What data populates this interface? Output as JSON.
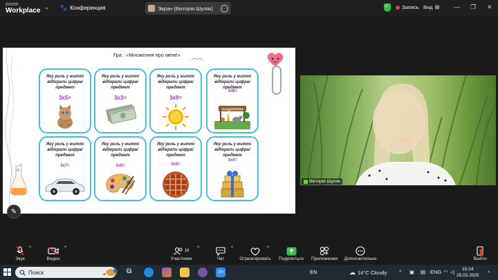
{
  "topbar": {
    "brand_top": "zoom",
    "brand_bottom": "Workplace",
    "meeting_label": "Конференция",
    "share_label": "Экран (Вікторія Шуляк)",
    "record_label": "Запись",
    "view_label": "Вид"
  },
  "slide": {
    "title": "Гра : «Множення про мене»",
    "question": "Яку роль у житті відіграли цифра/предмет",
    "cards": [
      {
        "expr": "3x5=",
        "icon": "kitten-image"
      },
      {
        "expr": "3x3=",
        "icon": "money-image"
      },
      {
        "expr": "3x9=",
        "icon": "sun-image"
      },
      {
        "expr": "3x8=",
        "icon": "zoo-image",
        "sign": "ZOOKEEPERS"
      },
      {
        "expr": "3x7=",
        "icon": "car-image"
      },
      {
        "expr": "3x6=",
        "icon": "palette-image"
      },
      {
        "expr": "3x5=",
        "icon": "pie-image"
      },
      {
        "expr": "3x4=",
        "icon": "gift-image"
      }
    ]
  },
  "video": {
    "participant_name": "Вікторія Шуляк"
  },
  "toolbar": {
    "audio": "Звук",
    "video": "Видео",
    "participants": "Участники",
    "participants_count": "16",
    "chat": "Чат",
    "react": "Отреагировать",
    "share": "Поделиться",
    "apps": "Приложения",
    "more": "Дополнительно",
    "leave": "Выйти"
  },
  "taskbar": {
    "search_placeholder": "Поиск",
    "lang_left": "EN",
    "weather": "14°C  Cloudy",
    "lang_right": "ENG",
    "time": "15:24",
    "date": "25.03.2025"
  },
  "colors": {
    "card_border": "#3fc1d9",
    "expr_purple": "#9b30c8",
    "share_green": "#2fbf4a",
    "record_red": "#e53935"
  }
}
